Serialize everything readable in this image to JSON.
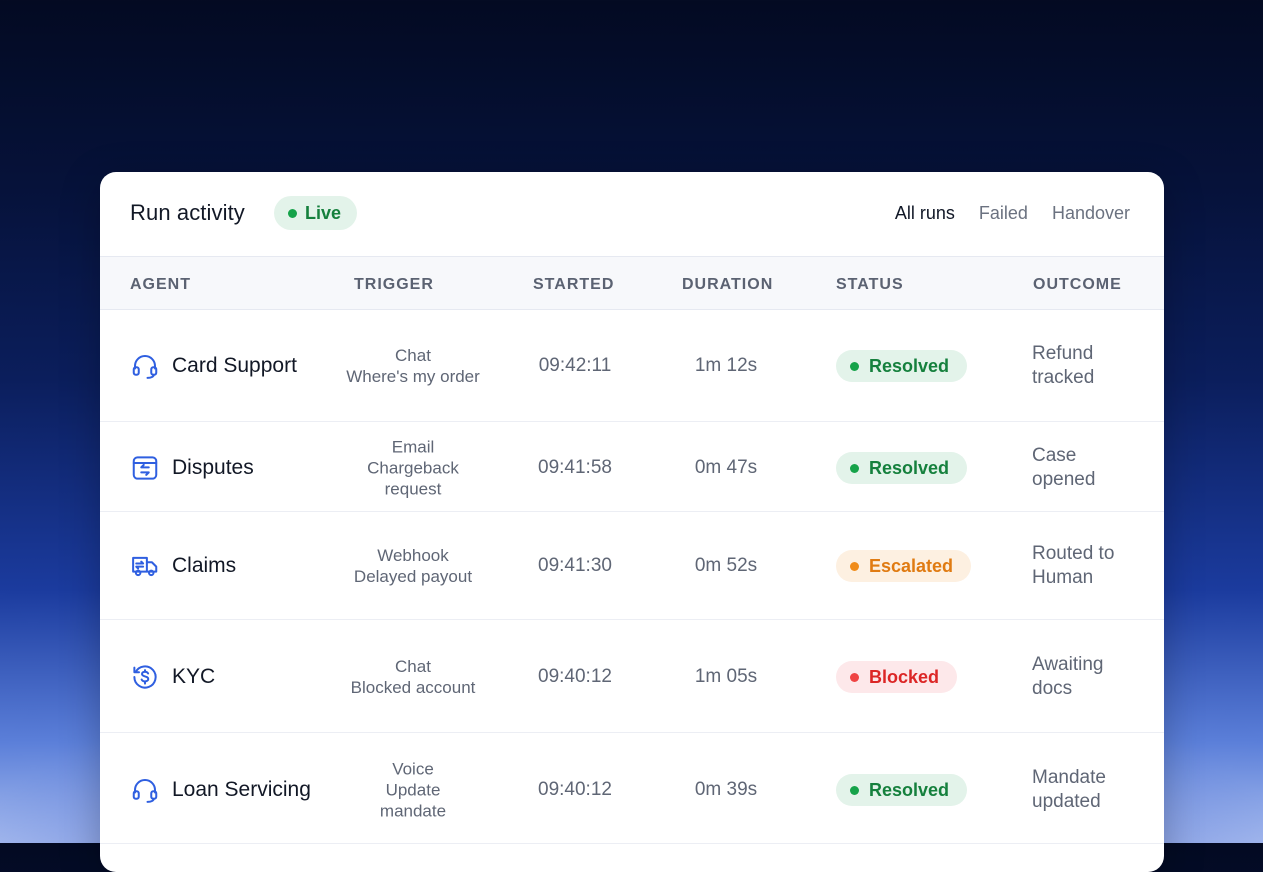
{
  "header": {
    "title": "Run activity",
    "live_label": "Live",
    "tabs": [
      {
        "label": "All runs",
        "active": true
      },
      {
        "label": "Failed",
        "active": false
      },
      {
        "label": "Handover",
        "active": false
      }
    ]
  },
  "columns": {
    "agent": "AGENT",
    "trigger": "TRIGGER",
    "started": "STARTED",
    "duration": "DURATION",
    "status": "STATUS",
    "outcome": "OUTCOME"
  },
  "status_colors": {
    "Resolved": {
      "fg": "#15803d",
      "bg": "#e3f3ea",
      "dot": "#16a34a"
    },
    "Escalated": {
      "fg": "#e07b12",
      "bg": "#fdf0e1",
      "dot": "#f08c1a"
    },
    "Blocked": {
      "fg": "#dc2626",
      "bg": "#fde8ea",
      "dot": "#ef4444"
    }
  },
  "accent_color": "#2f5fe0",
  "rows": [
    {
      "agent": "Card Support",
      "icon": "headset-icon",
      "trigger": [
        "Chat",
        "Where's my order"
      ],
      "started": "09:42:11",
      "duration": "1m 12s",
      "status": "Resolved",
      "outcome": [
        "Refund",
        "tracked"
      ]
    },
    {
      "agent": "Disputes",
      "icon": "exchange-icon",
      "trigger": [
        "Email",
        "Chargeback",
        "request"
      ],
      "started": "09:41:58",
      "duration": "0m 47s",
      "status": "Resolved",
      "outcome": [
        "Case",
        "opened"
      ]
    },
    {
      "agent": "Claims",
      "icon": "truck-icon",
      "trigger": [
        "Webhook",
        "Delayed payout"
      ],
      "started": "09:41:30",
      "duration": "0m 52s",
      "status": "Escalated",
      "outcome": [
        "Routed to",
        "Human"
      ]
    },
    {
      "agent": "KYC",
      "icon": "refund-dollar-icon",
      "trigger": [
        "Chat",
        "Blocked account"
      ],
      "started": "09:40:12",
      "duration": "1m 05s",
      "status": "Blocked",
      "outcome": [
        "Awaiting",
        "docs"
      ]
    },
    {
      "agent": "Loan Servicing",
      "icon": "headset-icon",
      "trigger": [
        "Voice",
        "Update",
        "mandate"
      ],
      "started": "09:40:12",
      "duration": "0m 39s",
      "status": "Resolved",
      "outcome": [
        "Mandate",
        "updated"
      ]
    }
  ]
}
